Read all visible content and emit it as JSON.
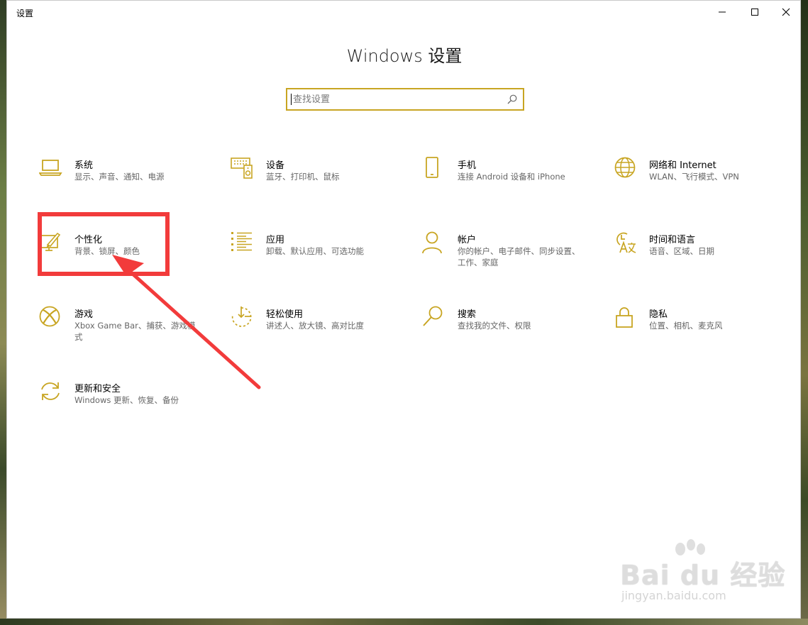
{
  "window": {
    "title": "设置",
    "controls": {
      "minimize": "minimize",
      "maximize": "maximize",
      "close": "close"
    }
  },
  "page": {
    "heading": "Windows 设置"
  },
  "search": {
    "placeholder": "查找设置"
  },
  "tiles": [
    {
      "name": "系统",
      "desc": "显示、声音、通知、电源",
      "icon": "laptop-icon"
    },
    {
      "name": "设备",
      "desc": "蓝牙、打印机、鼠标",
      "icon": "devices-icon"
    },
    {
      "name": "手机",
      "desc": "连接 Android 设备和 iPhone",
      "icon": "phone-icon"
    },
    {
      "name": "网络和 Internet",
      "desc": "WLAN、飞行模式、VPN",
      "icon": "globe-icon"
    },
    {
      "name": "个性化",
      "desc": "背景、锁屏、颜色",
      "icon": "personalization-icon"
    },
    {
      "name": "应用",
      "desc": "卸载、默认应用、可选功能",
      "icon": "apps-list-icon"
    },
    {
      "name": "帐户",
      "desc": "你的帐户、电子邮件、同步设置、工作、家庭",
      "icon": "account-icon"
    },
    {
      "name": "时间和语言",
      "desc": "语音、区域、日期",
      "icon": "time-language-icon"
    },
    {
      "name": "游戏",
      "desc": "Xbox Game Bar、捕获、游戏模式",
      "icon": "xbox-icon"
    },
    {
      "name": "轻松使用",
      "desc": "讲述人、放大镜、高对比度",
      "icon": "ease-of-access-icon"
    },
    {
      "name": "搜索",
      "desc": "查找我的文件、权限",
      "icon": "search-magnifier-icon"
    },
    {
      "name": "隐私",
      "desc": "位置、相机、麦克风",
      "icon": "lock-icon"
    },
    {
      "name": "更新和安全",
      "desc": "Windows 更新、恢复、备份",
      "icon": "sync-icon"
    }
  ],
  "colors": {
    "accent": "#c8a522",
    "annotation": "#f23b3b"
  },
  "watermark": {
    "logo": "Bai du 经验",
    "url": "jingyan.baidu.com"
  }
}
